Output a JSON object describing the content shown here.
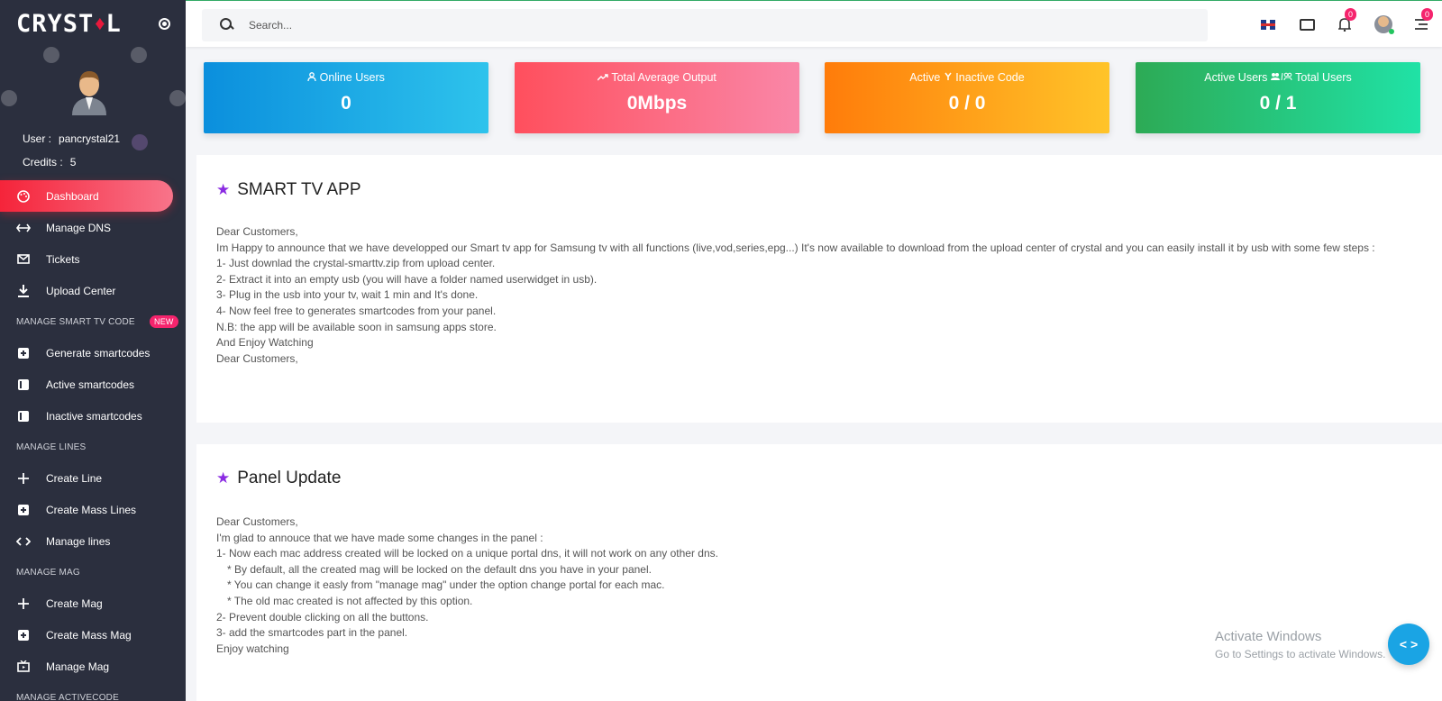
{
  "brand": {
    "logo_left": "CRYST",
    "logo_right": "L",
    "gem_glyph": "♦"
  },
  "user": {
    "user_label": "User :",
    "user_value": "pancrystal21",
    "credits_label": "Credits :",
    "credits_value": "5"
  },
  "sidebar": {
    "items_top": [
      {
        "label": "Dashboard",
        "icon": "palette-icon",
        "active": true
      },
      {
        "label": "Manage DNS",
        "icon": "arrows-horizontal-icon"
      },
      {
        "label": "Tickets",
        "icon": "envelope-icon"
      },
      {
        "label": "Upload Center",
        "icon": "download-icon"
      }
    ],
    "section_smart": {
      "heading": "MANAGE SMART TV CODE",
      "badge": "NEW"
    },
    "items_smart": [
      {
        "label": "Generate smartcodes",
        "icon": "plus-square-icon"
      },
      {
        "label": "Active smartcodes",
        "icon": "list-square-icon"
      },
      {
        "label": "Inactive smartcodes",
        "icon": "list-square-icon"
      }
    ],
    "section_lines": {
      "heading": "MANAGE LINES"
    },
    "items_lines": [
      {
        "label": "Create Line",
        "icon": "plus-icon"
      },
      {
        "label": "Create Mass Lines",
        "icon": "plus-square-icon"
      },
      {
        "label": "Manage lines",
        "icon": "code-icon"
      }
    ],
    "section_mag": {
      "heading": "MANAGE MAG"
    },
    "items_mag": [
      {
        "label": "Create Mag",
        "icon": "plus-icon"
      },
      {
        "label": "Create Mass Mag",
        "icon": "plus-square-icon"
      },
      {
        "label": "Manage Mag",
        "icon": "tv-icon"
      }
    ],
    "section_active": {
      "heading": "MANAGE ACTIVECODE"
    }
  },
  "topbar": {
    "search_placeholder": "Search...",
    "notifications_count": "0",
    "menu_count": "0"
  },
  "stats": [
    {
      "title": "Online Users",
      "value": "0",
      "icon": "user-icon"
    },
    {
      "title": "Total Average Output",
      "value": "0Mbps",
      "icon": "trend-up-icon"
    },
    {
      "title_a": "Active",
      "title_b": "Inactive Code",
      "value": "0 / 0",
      "icon": "branch-icon"
    },
    {
      "title_a": "Active Users",
      "title_b": "Total Users",
      "value": "0 / 1",
      "icon": "users-icon"
    }
  ],
  "panel_smart_tv": {
    "title": "SMART TV APP",
    "lines": [
      "Dear Customers,",
      "Im Happy to announce that we have developped our Smart tv app for Samsung tv with all functions (live,vod,series,epg...) It's now available to download from the upload center of crystal and you can easily install it by usb with some few steps :",
      "1- Just downlad the crystal-smarttv.zip from upload center.",
      "2- Extract it into an empty usb (you will have a folder named userwidget in usb).",
      "3- Plug in the usb into your tv, wait 1 min and It's done.",
      "4- Now feel free to generates smartcodes from your panel.",
      "N.B: the app will be available soon in samsung apps store.",
      "And Enjoy Watching",
      "Dear Customers,"
    ]
  },
  "panel_update": {
    "title": "Panel Update",
    "lines": [
      "Dear Customers,",
      "I'm glad to annouce that we have made some changes in the panel :",
      "1- Now each mac address created will be locked on a unique portal dns, it will not work on any other dns.",
      "* By default, all the created mag will be locked on the default dns you have in your panel.",
      "* You can change it easly from \"manage mag\" under the option change portal for each mac.",
      "* The old mac created is not affected by this option.",
      "2- Prevent double clicking on all the buttons.",
      "3- add the smartcodes part in the panel.",
      "Enjoy watching"
    ]
  },
  "watermark": {
    "line1": "Activate Windows",
    "line2": "Go to Settings to activate Windows."
  },
  "fab_glyph": "< >"
}
